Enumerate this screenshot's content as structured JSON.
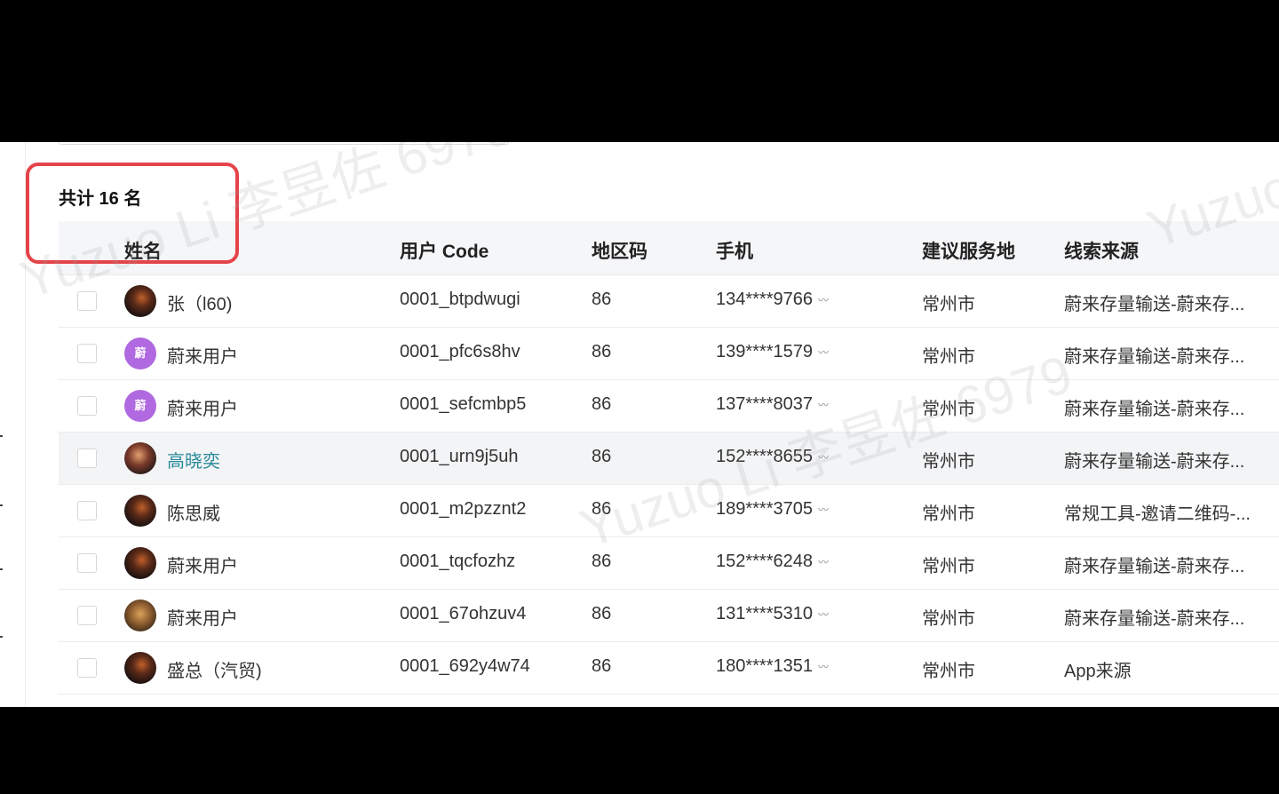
{
  "summary": {
    "total_label": "共计 16 名"
  },
  "table": {
    "headers": {
      "name": "姓名",
      "user_code": "用户 Code",
      "area_code": "地区码",
      "phone": "手机",
      "service_city": "建议服务地",
      "lead_source": "线索来源"
    },
    "rows": [
      {
        "name": "张（l60)",
        "code": "0001_btpdwugi",
        "area": "86",
        "phone": "134****9766",
        "city": "常州市",
        "source": "蔚来存量输送-蔚来存..."
      },
      {
        "name": "蔚来用户",
        "code": "0001_pfc6s8hv",
        "area": "86",
        "phone": "139****1579",
        "city": "常州市",
        "source": "蔚来存量输送-蔚来存..."
      },
      {
        "name": "蔚来用户",
        "code": "0001_sefcmbp5",
        "area": "86",
        "phone": "137****8037",
        "city": "常州市",
        "source": "蔚来存量输送-蔚来存..."
      },
      {
        "name": "高晓奕",
        "code": "0001_urn9j5uh",
        "area": "86",
        "phone": "152****8655",
        "city": "常州市",
        "source": "蔚来存量输送-蔚来存..."
      },
      {
        "name": "陈思威",
        "code": "0001_m2pzznt2",
        "area": "86",
        "phone": "189****3705",
        "city": "常州市",
        "source": "常规工具-邀请二维码-..."
      },
      {
        "name": "蔚来用户",
        "code": "0001_tqcfozhz",
        "area": "86",
        "phone": "152****6248",
        "city": "常州市",
        "source": "蔚来存量输送-蔚来存..."
      },
      {
        "name": "蔚来用户",
        "code": "0001_67ohzuv4",
        "area": "86",
        "phone": "131****5310",
        "city": "常州市",
        "source": "蔚来存量输送-蔚来存..."
      },
      {
        "name": "盛总（汽贸)",
        "code": "0001_692y4w74",
        "area": "86",
        "phone": "180****1351",
        "city": "常州市",
        "source": "App来源"
      }
    ]
  },
  "avatar_badge": "蔚",
  "phone_reveal_icon": "eye-closed-icon",
  "watermark": {
    "text_1": "Yuzuo Li 李昱佐 6979",
    "text_2": "Yuzuo"
  },
  "colors": {
    "highlight": "#e5434a",
    "link": "#2a8a9a",
    "avatar_purple": "#b069e0"
  }
}
